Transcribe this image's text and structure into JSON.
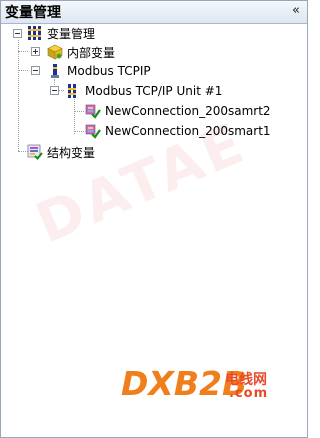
{
  "panel": {
    "title": "变量管理",
    "collapse_glyph": "«"
  },
  "tree": {
    "root": {
      "label": "变量管理",
      "icon": "variable-table-icon",
      "expanded": true
    },
    "internal": {
      "label": "内部变量",
      "icon": "cube-icon",
      "expanded": false
    },
    "modbus": {
      "label": "Modbus TCPIP",
      "icon": "driver-icon",
      "expanded": true
    },
    "unit": {
      "label": "Modbus TCP/IP Unit #1",
      "icon": "variable-table-icon",
      "expanded": true
    },
    "connections": [
      {
        "label": "NewConnection_200samrt2",
        "icon": "connection-check-icon"
      },
      {
        "label": "NewConnection_200smart1",
        "icon": "connection-check-icon"
      }
    ],
    "struct": {
      "label": "结构变量",
      "icon": "structure-icon"
    }
  },
  "watermark": "DATAE",
  "logo": {
    "main": "DXB2B",
    "cn": "电线网",
    "com": ".com"
  },
  "colors": {
    "header_gradient_top": "#f5f8fc",
    "header_gradient_bottom": "#dde6f1",
    "logo_orange": "#f07e1a",
    "logo_red": "#e84a2a"
  }
}
